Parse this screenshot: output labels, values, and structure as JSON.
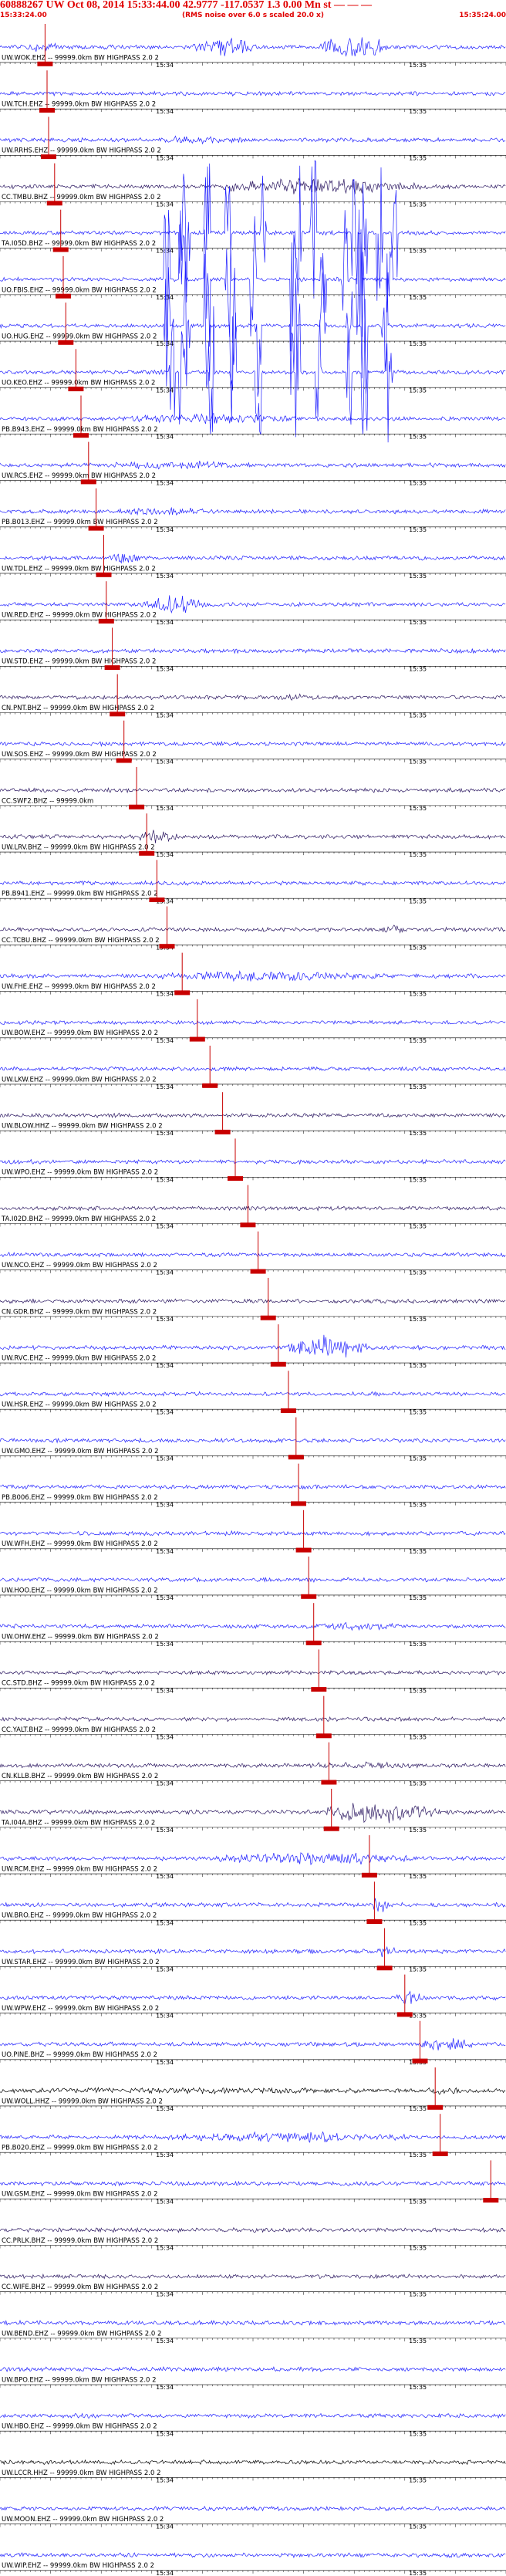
{
  "header": {
    "title": "60888267 UW Oct 08, 2014 15:33:44.00   42.9777 -117.0537  1.3 0.00 Mn st — — —",
    "start_time": "15:33:24.00",
    "scale_note": "(RMS noise over 6.0 s scaled 20.0 x)",
    "end_time": "15:35:24.00"
  },
  "colors": {
    "header_text": "#e00000",
    "trace_blue": "#1f1fff",
    "trace_purple": "#2a1660",
    "trace_black": "#000000",
    "pick_marker": "#c80000",
    "tick_line": "#000000"
  },
  "chart_data": {
    "type": "seismogram-record-section",
    "time_range": [
      "15:33:24.00",
      "15:35:24.00"
    ],
    "minute_labels": [
      "15:34",
      "15:35"
    ],
    "traces": [
      {
        "label": "UW.WOK.EHZ -- 99999.0km BW HIGHPASS 2.0 2",
        "color": "blue",
        "pick": 0.089,
        "burst": [
          [
            0.38,
            0.55,
            5
          ],
          [
            0.62,
            0.82,
            6
          ],
          [
            0.05,
            0.14,
            2.5
          ]
        ]
      },
      {
        "label": "UW.TCH.EHZ -- 99999.0km BW HIGHPASS 2.0 2",
        "color": "blue",
        "pick": 0.093
      },
      {
        "label": "UW.RRHS.EHZ -- 99999.0km BW HIGHPASS 2.0 2",
        "color": "blue",
        "pick": 0.096,
        "burst": [
          [
            0.3,
            0.55,
            2
          ]
        ]
      },
      {
        "label": "CC.TMBU.BHZ -- 99999.0km BW HIGHPASS 2.0 2",
        "color": "purple",
        "pick": 0.108,
        "burst": [
          [
            0.4,
            1.0,
            4
          ]
        ]
      },
      {
        "label": "TA.I05D.BHZ -- 99999.0km BW HIGHPASS 2.0 2",
        "color": "blue",
        "pick": 0.12,
        "spikes": [
          0.36,
          0.37,
          0.41,
          0.45,
          0.52,
          0.59,
          0.62,
          0.7,
          0.72,
          0.75,
          0.78
        ]
      },
      {
        "label": "UO.FBIS.EHZ -- 99999.0km BW HIGHPASS 2.0 2",
        "color": "blue",
        "pick": 0.125,
        "spikes": [
          0.33,
          0.36,
          0.41,
          0.45,
          0.5,
          0.58,
          0.64,
          0.68,
          0.71,
          0.77
        ]
      },
      {
        "label": "UO.HUG.EHZ -- 99999.0km BW HIGHPASS 2.0 2",
        "color": "blue",
        "pick": 0.13,
        "spikes": [
          0.33,
          0.37,
          0.41,
          0.46,
          0.51,
          0.58,
          0.64,
          0.69,
          0.72,
          0.76
        ]
      },
      {
        "label": "UO.KEO.EHZ -- 99999.0km BW HIGHPASS 2.0 2",
        "color": "blue",
        "pick": 0.15,
        "spikes": [
          0.34,
          0.36,
          0.42,
          0.46,
          0.51,
          0.59,
          0.63,
          0.69,
          0.72,
          0.77
        ]
      },
      {
        "label": "PB.B943.EHZ -- 99999.0km BW HIGHPASS 2.0 2",
        "color": "blue",
        "pick": 0.16,
        "burst": [
          [
            0.22,
            0.7,
            2.5
          ]
        ]
      },
      {
        "label": "UW.RCS.EHZ -- 99999.0km BW HIGHPASS 2.0 2",
        "color": "blue",
        "pick": 0.175,
        "burst": [
          [
            0.2,
            0.6,
            2
          ]
        ]
      },
      {
        "label": "PB.B013.EHZ -- 99999.0km BW HIGHPASS 2.0 2",
        "color": "blue",
        "pick": 0.19,
        "burst": [
          [
            0.22,
            0.5,
            2
          ]
        ]
      },
      {
        "label": "UW.TDL.EHZ -- 99999.0km BW HIGHPASS 2.0 2",
        "color": "blue",
        "pick": 0.205,
        "burst": [
          [
            0.21,
            0.3,
            3
          ]
        ]
      },
      {
        "label": "UW.RED.EHZ -- 99999.0km BW HIGHPASS 2.0 2",
        "color": "blue",
        "pick": 0.21,
        "burst": [
          [
            0.27,
            0.46,
            5
          ]
        ]
      },
      {
        "label": "UW.STD.EHZ -- 99999.0km BW HIGHPASS 2.0 2",
        "color": "blue",
        "pick": 0.222
      },
      {
        "label": "CN.PNT.BHZ -- 99999.0km BW HIGHPASS 2.0 2",
        "color": "purple",
        "pick": 0.232,
        "burst": [
          [
            0.56,
            0.62,
            2
          ]
        ]
      },
      {
        "label": "UW.SOS.EHZ -- 99999.0km BW HIGHPASS 2.0 2",
        "color": "blue",
        "pick": 0.245
      },
      {
        "label": "CC.SWF2.BHZ -- 99999.0km",
        "color": "purple",
        "pick": 0.27
      },
      {
        "label": "UW.LRV.BHZ -- 99999.0km BW HIGHPASS 2.0 2",
        "color": "purple",
        "pick": 0.29,
        "burst": [
          [
            0.27,
            0.38,
            3.5
          ]
        ]
      },
      {
        "label": "PB.B941.EHZ -- 99999.0km BW HIGHPASS 2.0 2",
        "color": "blue",
        "pick": 0.31
      },
      {
        "label": "CC.TCBU.BHZ -- 99999.0km BW HIGHPASS 2.0 2",
        "color": "purple",
        "pick": 0.33,
        "burst": [
          [
            0.75,
            0.82,
            2
          ]
        ]
      },
      {
        "label": "UW.FHE.EHZ -- 99999.0km BW HIGHPASS 2.0 2",
        "color": "blue",
        "pick": 0.36,
        "burst": [
          [
            0.28,
            0.92,
            2.6
          ]
        ]
      },
      {
        "label": "UW.BOW.EHZ -- 99999.0km BW HIGHPASS 2.0 2",
        "color": "blue",
        "pick": 0.39
      },
      {
        "label": "UW.LKW.EHZ -- 99999.0km BW HIGHPASS 2.0 2",
        "color": "blue",
        "pick": 0.415
      },
      {
        "label": "UW.BLOW.HHZ -- 99999.0km BW HIGHPASS 2.0 2",
        "color": "purple",
        "pick": 0.44
      },
      {
        "label": "UW.WPO.EHZ -- 99999.0km BW HIGHPASS 2.0 2",
        "color": "blue",
        "pick": 0.465
      },
      {
        "label": "TA.I02D.BHZ -- 99999.0km BW HIGHPASS 2.0 2",
        "color": "purple",
        "pick": 0.49
      },
      {
        "label": "UW.NCO.EHZ -- 99999.0km BW HIGHPASS 2.0 2",
        "color": "blue",
        "pick": 0.51
      },
      {
        "label": "CN.GDR.BHZ -- 99999.0km BW HIGHPASS 2.0 2",
        "color": "purple",
        "pick": 0.53
      },
      {
        "label": "UW.RVC.EHZ -- 99999.0km BW HIGHPASS 2.0 2",
        "color": "blue",
        "pick": 0.55,
        "burst": [
          [
            0.56,
            0.79,
            5.5
          ]
        ]
      },
      {
        "label": "UW.HSR.EHZ -- 99999.0km BW HIGHPASS 2.0 2",
        "color": "blue",
        "pick": 0.57
      },
      {
        "label": "UW.GMO.EHZ -- 99999.0km BW HIGHPASS 2.0 2",
        "color": "blue",
        "pick": 0.585
      },
      {
        "label": "PB.B006.EHZ -- 99999.0km BW HIGHPASS 2.0 2",
        "color": "blue",
        "pick": 0.59
      },
      {
        "label": "UW.WFH.EHZ -- 99999.0km BW HIGHPASS 2.0 2",
        "color": "blue",
        "pick": 0.6
      },
      {
        "label": "UW.HOO.EHZ -- 99999.0km BW HIGHPASS 2.0 2",
        "color": "blue",
        "pick": 0.61
      },
      {
        "label": "UW.OHW.EHZ -- 99999.0km BW HIGHPASS 2.0 2",
        "color": "blue",
        "pick": 0.62,
        "burst": [
          [
            0.6,
            0.85,
            1.8
          ]
        ]
      },
      {
        "label": "CC.STD.BHZ -- 99999.0km BW HIGHPASS 2.0 2",
        "color": "purple",
        "pick": 0.63
      },
      {
        "label": "CC.YALT.BHZ -- 99999.0km BW HIGHPASS 2.0 2",
        "color": "purple",
        "pick": 0.64
      },
      {
        "label": "CN.KLLB.BHZ -- 99999.0km BW HIGHPASS 2.0 2",
        "color": "purple",
        "pick": 0.65,
        "burst": [
          [
            0.6,
            0.9,
            1.8
          ]
        ]
      },
      {
        "label": "TA.I04A.BHZ -- 99999.0km BW HIGHPASS 2.0 2",
        "color": "purple",
        "pick": 0.655,
        "burst": [
          [
            0.62,
            0.96,
            5.5
          ]
        ]
      },
      {
        "label": "UW.RCM.EHZ -- 99999.0km BW HIGHPASS 2.0 2",
        "color": "blue",
        "pick": 0.73,
        "burst": [
          [
            0.4,
            0.98,
            3
          ]
        ]
      },
      {
        "label": "UW.BRO.EHZ -- 99999.0km BW HIGHPASS 2.0 2",
        "color": "blue",
        "pick": 0.74,
        "burst": [
          [
            0.73,
            0.78,
            4
          ]
        ]
      },
      {
        "label": "UW.STAR.EHZ -- 99999.0km BW HIGHPASS 2.0 2",
        "color": "blue",
        "pick": 0.76,
        "burst": [
          [
            0.74,
            0.8,
            3.5
          ]
        ]
      },
      {
        "label": "UW.WPW.EHZ -- 99999.0km BW HIGHPASS 2.0 2",
        "color": "blue",
        "pick": 0.8,
        "burst": [
          [
            0.78,
            0.86,
            3
          ]
        ]
      },
      {
        "label": "UO.PINE.BHZ -- 99999.0km BW HIGHPASS 2.0 2",
        "color": "blue",
        "pick": 0.83,
        "burst": [
          [
            0.82,
            0.98,
            3.5
          ]
        ]
      },
      {
        "label": "UW.WOLL.HHZ -- 99999.0km BW HIGHPASS 2.0 2",
        "color": "black",
        "pick": 0.86,
        "burst": [
          [
            0.0,
            1.0,
            1.5
          ],
          [
            0.84,
            0.96,
            2.5
          ]
        ]
      },
      {
        "label": "PB.B020.EHZ -- 99999.0km BW HIGHPASS 2.0 2",
        "color": "blue",
        "pick": 0.87,
        "burst": [
          [
            0.3,
            1.0,
            2.4
          ]
        ]
      },
      {
        "label": "UW.GSM.EHZ -- 99999.0km BW HIGHPASS 2.0 2",
        "color": "blue",
        "pick": 0.97
      },
      {
        "label": "CC.PRLK.BHZ -- 99999.0km BW HIGHPASS 2.0 2",
        "color": "purple"
      },
      {
        "label": "CC.WIFE.BHZ -- 99999.0km BW HIGHPASS 2.0 2",
        "color": "purple"
      },
      {
        "label": "UW.BEND.EHZ -- 99999.0km BW HIGHPASS 2.0 2",
        "color": "blue"
      },
      {
        "label": "UW.BPO.EHZ -- 99999.0km BW HIGHPASS 2.0 2",
        "color": "blue"
      },
      {
        "label": "UW.HBO.EHZ -- 99999.0km BW HIGHPASS 2.0 2",
        "color": "blue"
      },
      {
        "label": "UW.LCCR.HHZ -- 99999.0km BW HIGHPASS 2.0 2",
        "color": "black"
      },
      {
        "label": "UW.MOON.EHZ -- 99999.0km BW HIGHPASS 2.0 2",
        "color": "blue"
      },
      {
        "label": "UW.WIP.EHZ -- 99999.0km BW HIGHPASS 2.0 2",
        "color": "blue"
      }
    ]
  }
}
